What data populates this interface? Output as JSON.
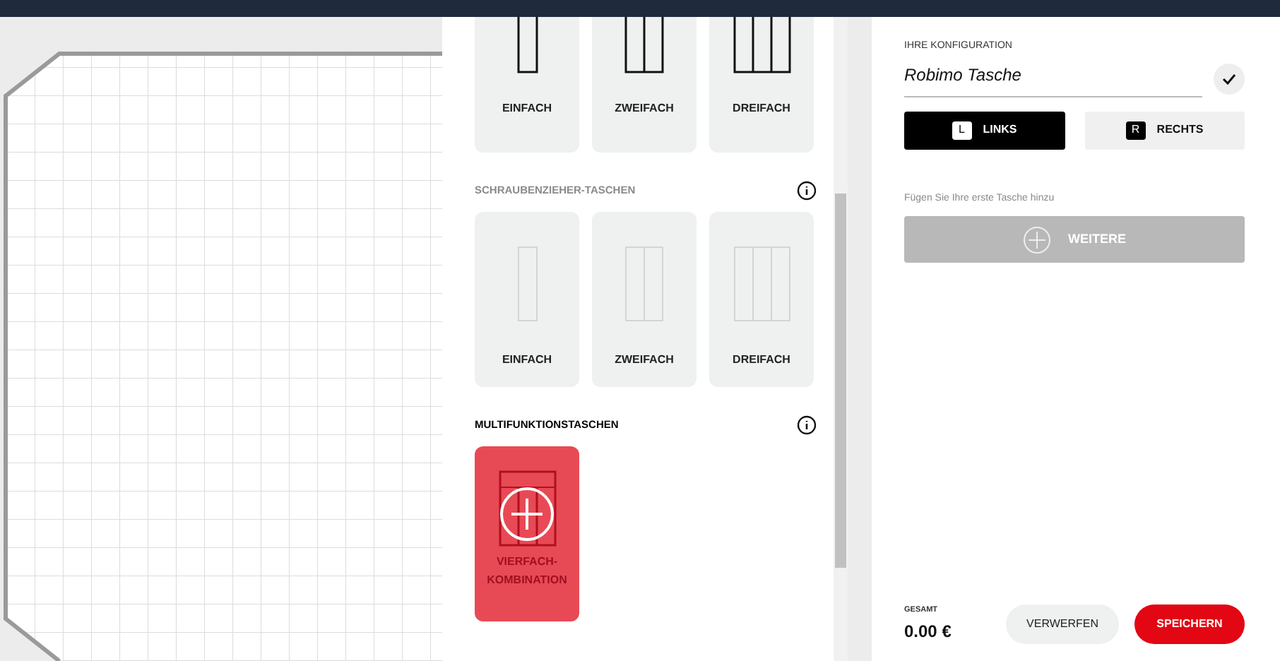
{
  "sections": [
    {
      "cards": [
        {
          "label": "EINFACH",
          "kind": "single",
          "selected": false
        },
        {
          "label": "ZWEIFACH",
          "kind": "double",
          "selected": false
        },
        {
          "label": "DREIFACH",
          "kind": "triple",
          "selected": false
        }
      ]
    },
    {
      "title": "SCHRAUBENZIEHER-TASCHEN",
      "info": true,
      "cards": [
        {
          "label": "EINFACH",
          "kind": "single",
          "selected": false
        },
        {
          "label": "ZWEIFACH",
          "kind": "double",
          "selected": false
        },
        {
          "label": "DREIFACH",
          "kind": "triple",
          "selected": false
        }
      ]
    },
    {
      "title": "MULTIFUNKTIONSTASCHEN",
      "info": true,
      "cards": [
        {
          "label": "VIERFACH-KOMBINATION",
          "kind": "quad",
          "selected": true
        }
      ]
    }
  ],
  "config": {
    "heading": "IHRE KONFIGURATION",
    "name": "Robimo Tasche",
    "sides": [
      {
        "key": "L",
        "label": "LINKS",
        "selected": true
      },
      {
        "key": "R",
        "label": "RECHTS",
        "selected": false
      }
    ],
    "hint": "Fügen Sie Ihre erste Tasche hinzu",
    "add_button": "WEITERE"
  },
  "footer": {
    "total_label": "GESAMT",
    "total": "0.00 €",
    "discard": "VERWERFEN",
    "save": "SPEICHERN"
  }
}
